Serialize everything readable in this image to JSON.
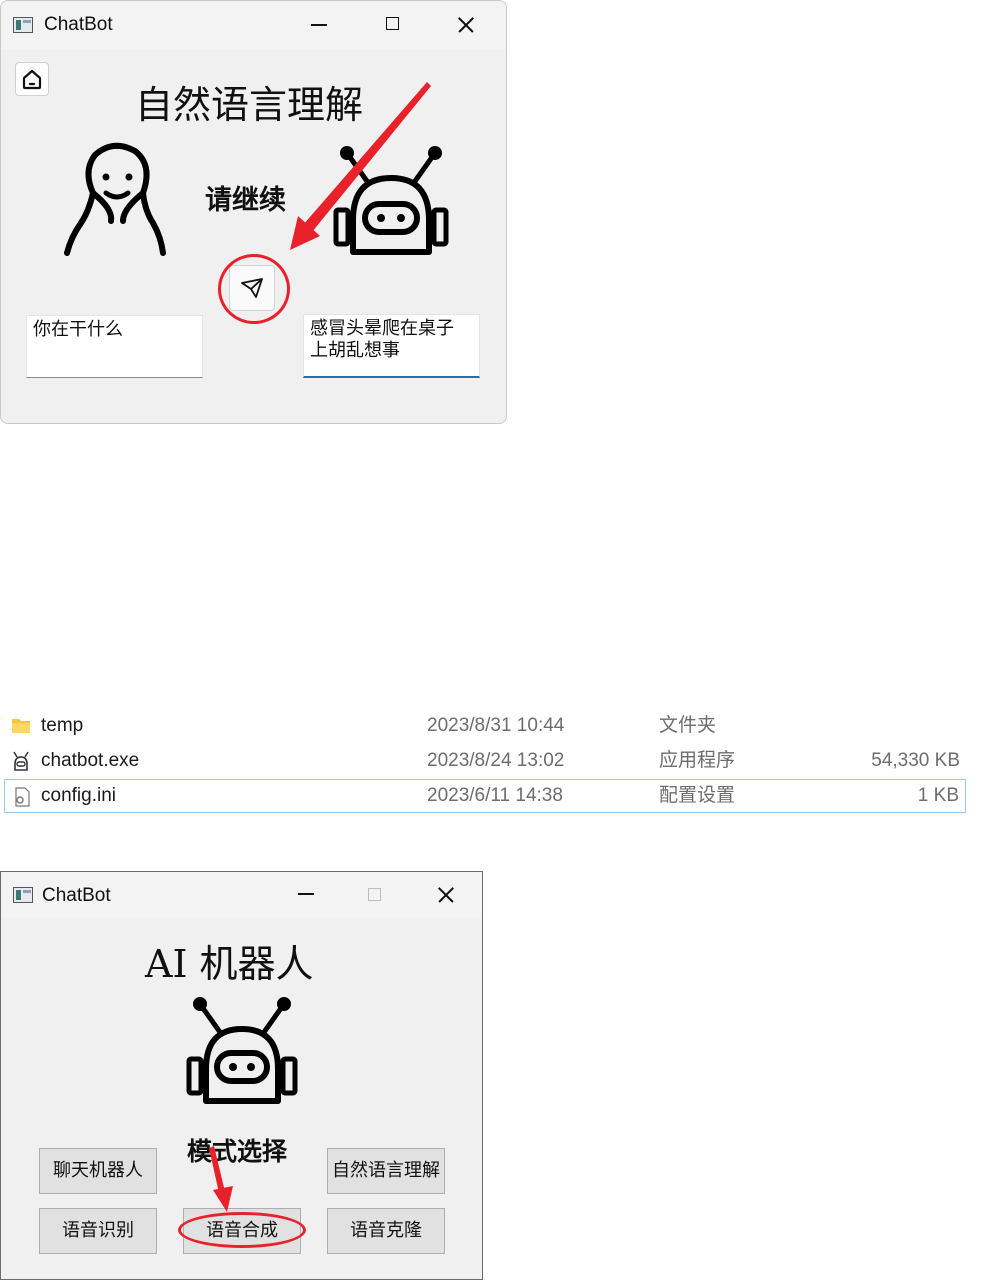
{
  "window1": {
    "title": "ChatBot",
    "heading": "自然语言理解",
    "status": "请继续",
    "user_text": "你在干什么",
    "bot_text": "感冒头晕爬在桌子\n上胡乱想事",
    "icons": [
      "app-icon",
      "home-icon",
      "person-icon",
      "robot-icon",
      "send-icon",
      "minimize-icon",
      "maximize-icon",
      "close-icon"
    ]
  },
  "file_list": {
    "rows": [
      {
        "name": "temp",
        "date": "2023/8/31 10:44",
        "type": "文件夹",
        "size": "",
        "icon": "folder-icon"
      },
      {
        "name": "chatbot.exe",
        "date": "2023/8/24 13:02",
        "type": "应用程序",
        "size": "54,330 KB",
        "icon": "robot-exe-icon"
      },
      {
        "name": "config.ini",
        "date": "2023/6/11 14:38",
        "type": "配置设置",
        "size": "1 KB",
        "icon": "config-file-icon"
      }
    ]
  },
  "window2": {
    "title": "ChatBot",
    "heading": "AI 机器人",
    "mode_label": "模式选择",
    "buttons": {
      "chat": "聊天机器人",
      "nlu": "自然语言理解",
      "asr": "语音识别",
      "tts": "语音合成",
      "clone": "语音克隆"
    }
  },
  "colors": {
    "annotation": "#e8212a",
    "window_bg": "#f0f0f0",
    "selection_border": "#99c9ef",
    "focus_underline": "#1f6fb5"
  }
}
